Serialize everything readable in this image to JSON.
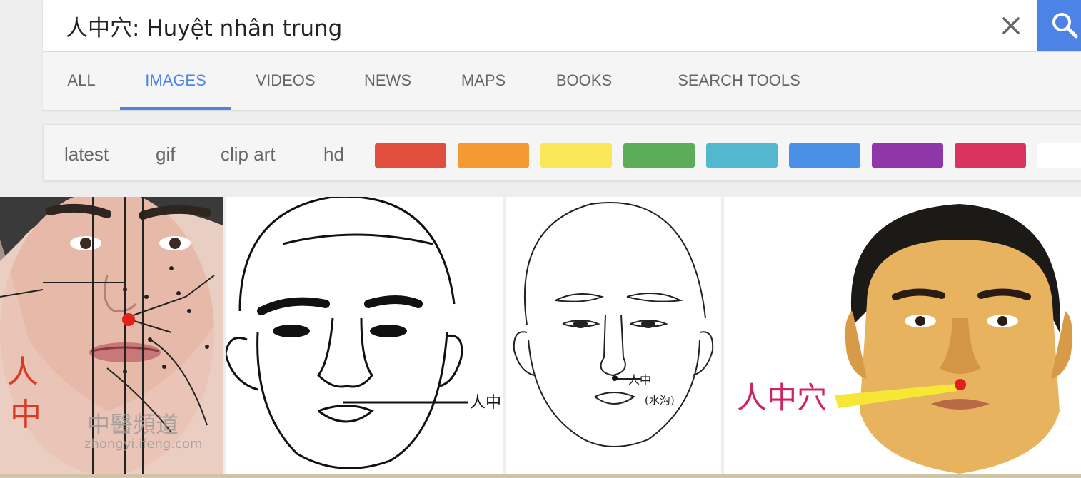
{
  "search": {
    "query": "人中穴: Huyệt nhân trung"
  },
  "tabs": [
    {
      "label": "ALL"
    },
    {
      "label": "IMAGES",
      "active": true
    },
    {
      "label": "VIDEOS"
    },
    {
      "label": "NEWS"
    },
    {
      "label": "MAPS"
    },
    {
      "label": "BOOKS"
    },
    {
      "label": "SEARCH TOOLS"
    }
  ],
  "filters": {
    "chips": [
      "latest",
      "gif",
      "clip art",
      "hd"
    ],
    "colors": [
      "#e04f3c",
      "#f39a33",
      "#fbe85a",
      "#5cad59",
      "#53b8cf",
      "#4a90e6",
      "#8e36aa",
      "#d9335f",
      "#ffffff"
    ]
  },
  "results": {
    "image1": {
      "label_vertical_1": "人",
      "label_vertical_2": "中",
      "watermark": "中醫頻道",
      "watermark_url": "zhongyi.ifeng.com"
    },
    "image2": {
      "label": "人中"
    },
    "image3": {
      "label": "人中",
      "sub_label": "(水沟)"
    },
    "image4": {
      "label": "人中穴"
    }
  }
}
